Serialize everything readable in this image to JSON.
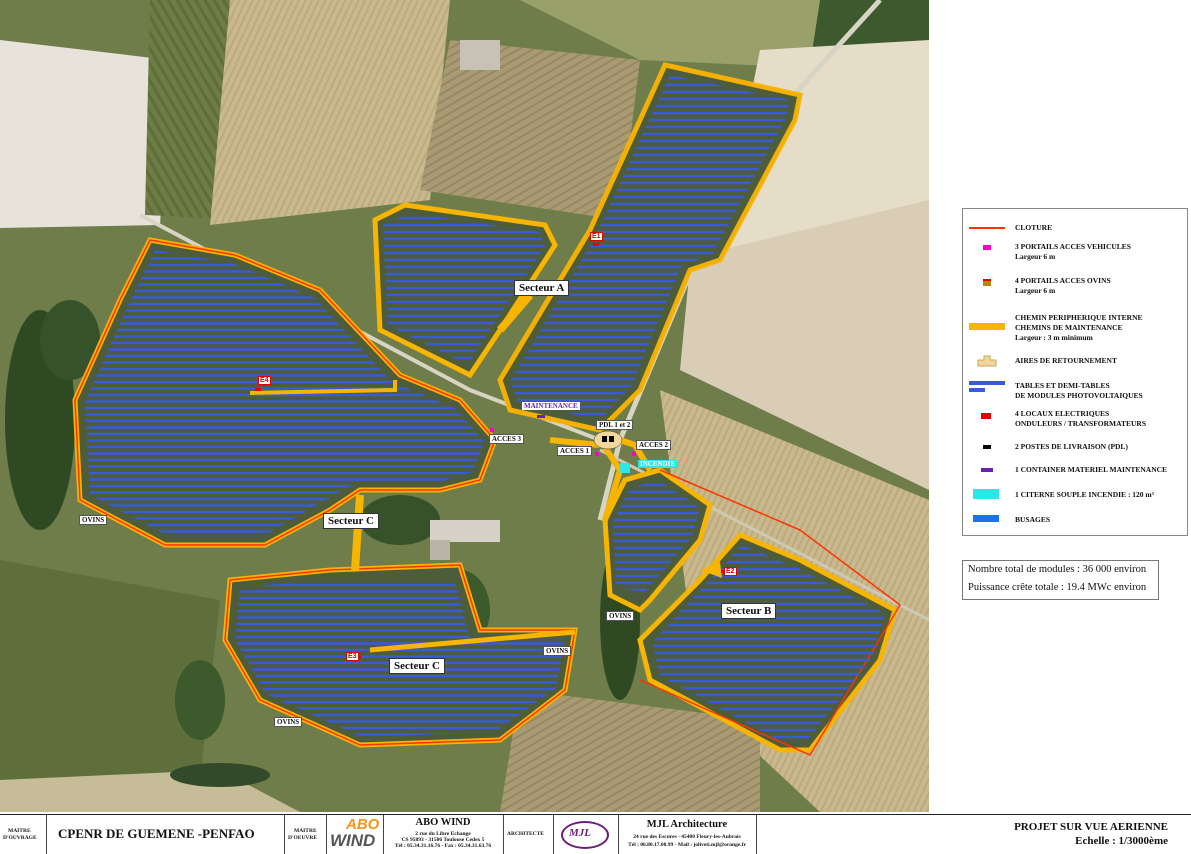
{
  "map": {
    "sectors": [
      "Secteur A",
      "Secteur B",
      "Secteur C",
      "Secteur C"
    ],
    "access": [
      "ACCES 1",
      "ACCES 2",
      "ACCES 3"
    ],
    "ovins": [
      "OVINS",
      "OVINS",
      "OVINS",
      "OVINS"
    ],
    "pdl": "PDL 1 et 2",
    "maintenance": "MAINTENANCE",
    "incendie": "INCENDIE",
    "electrical": [
      "E1",
      "E2",
      "E3",
      "E4"
    ]
  },
  "legend": {
    "items": [
      {
        "lines": [
          "CLOTURE"
        ],
        "symbol": "fence",
        "color": "#ff3300"
      },
      {
        "lines": [
          "3 PORTAILS ACCES VEHICULES",
          "Largeur 6 m"
        ],
        "symbol": "vehicle-gate-icon",
        "color": "#ff00cc"
      },
      {
        "lines": [
          "4 PORTAILS ACCES OVINS",
          "Largeur 6 m"
        ],
        "symbol": "sheep-gate-icon",
        "color": "#b8860b"
      },
      {
        "lines": [
          "CHEMIN PERIPHERIQUE INTERNE",
          "CHEMINS DE MAINTENANCE",
          "Largeur : 3 m minimum"
        ],
        "symbol": "path",
        "color": "#f7b500"
      },
      {
        "lines": [
          "AIRES DE RETOURNEMENT"
        ],
        "symbol": "turnaround-icon",
        "color": "#f2d79a"
      },
      {
        "lines": [
          "TABLES ET DEMI-TABLES",
          "DE MODULES PHOTOVOLTAIQUES"
        ],
        "symbol": "pv-tables-icon",
        "color": "#3a5bd9"
      },
      {
        "lines": [
          "4 LOCAUX ELECTRIQUES",
          "ONDULEURS / TRANSFORMATEURS"
        ],
        "symbol": "electrical-room-icon",
        "color": "#e60000"
      },
      {
        "lines": [
          "2 POSTES DE LIVRAISON (PDL)"
        ],
        "symbol": "delivery-station-icon",
        "color": "#000000"
      },
      {
        "lines": [
          "1 CONTAINER MATERIEL MAINTENANCE"
        ],
        "symbol": "container-icon",
        "color": "#6a1fb5"
      },
      {
        "lines": [
          "1 CITERNE SOUPLE INCENDIE : 120 m³"
        ],
        "symbol": "water-tank-icon",
        "color": "#2ee6e6"
      },
      {
        "lines": [
          "BUSAGES"
        ],
        "symbol": "culvert-icon",
        "color": "#1a73e8"
      }
    ]
  },
  "stats": {
    "modules": "Nombre total de modules : 36 000 environ",
    "power": "Puissance crête totale : 19.4 MWc environ"
  },
  "footer": {
    "owner_label_1": "MAITRE",
    "owner_label_2": "D'OUVRAGE",
    "project_name": "CPENR DE GUEMENE -PENFAO",
    "builder_label_1": "MAITRE",
    "builder_label_2": "D'OEUVRE",
    "abo_logo_top": "ABO",
    "abo_logo_bottom": "WIND",
    "abo_name": "ABO WIND",
    "abo_addr1": "2 rue du Libre Echange",
    "abo_addr2": "CS 95893 - 31506 Toulouse Cedex 5",
    "abo_addr3": "Tél : 05.34.31.16.76 - Fax : 05.34.31.63.76",
    "architect_label": "ARCHITECTE",
    "mjl_logo": "MJL",
    "mjl_name": "MJL Architecture",
    "mjl_addr1": "24 rue des Escures - 45400 Fleury-les-Aubrais",
    "mjl_addr2": "Tél : 06.80.17.08.99 - Mail : joliveti.mjl@orange.fr",
    "drawing_title": "PROJET SUR VUE AERIENNE",
    "scale": "Echelle : 1/3000ème"
  }
}
